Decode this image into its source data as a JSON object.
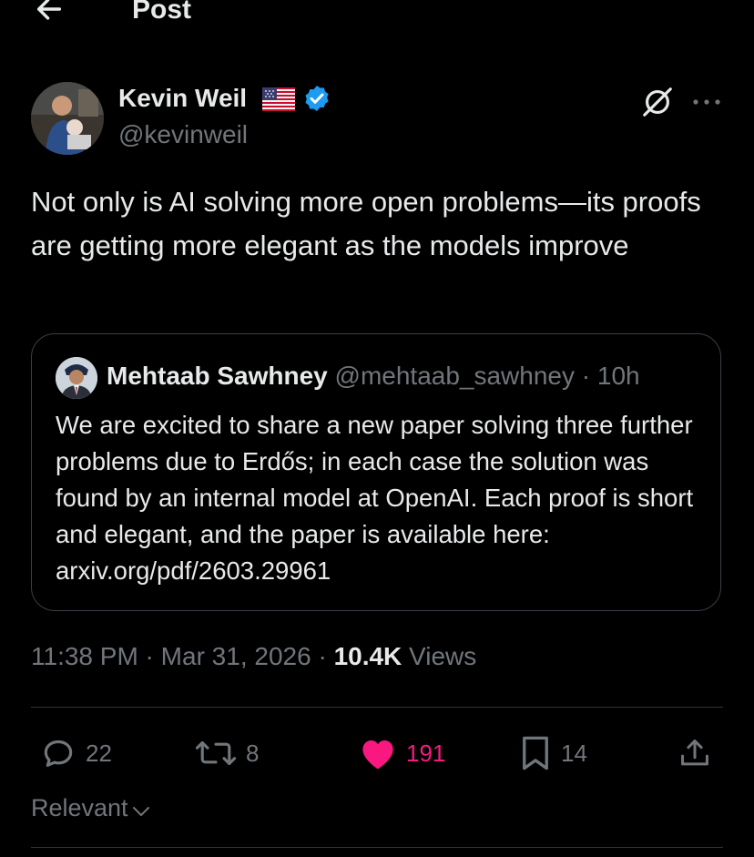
{
  "header": {
    "title": "Post",
    "back_icon": "arrow-left-icon"
  },
  "author": {
    "name": "Kevin Weil",
    "handle": "@kevinweil",
    "flag_icon": "us-flag-icon",
    "verified_icon": "verified-badge-icon",
    "verified_color": "#1d9bf0"
  },
  "post": {
    "text": "Not only is AI solving more open problems—its proofs are getting more elegant as the models improve"
  },
  "quote": {
    "name": "Mehtaab Sawhney",
    "handle": "@mehtaab_sawhney",
    "separator": " · ",
    "time": "10h",
    "text": "We are excited to share a new paper solving three further problems due to Erdős; in each case the solution was found by an internal model at OpenAI. Each proof is short and elegant, and the paper is available here: arxiv.org/pdf/2603.29961"
  },
  "meta": {
    "time": "11:38 PM",
    "separator": " · ",
    "date": "Mar 31, 2026",
    "views_count": "10.4K",
    "views_label": " Views"
  },
  "actions": {
    "replies": "22",
    "reposts": "8",
    "likes": "191",
    "bookmarks": "14",
    "like_color": "#f91880"
  },
  "sort": {
    "label": "Relevant"
  }
}
